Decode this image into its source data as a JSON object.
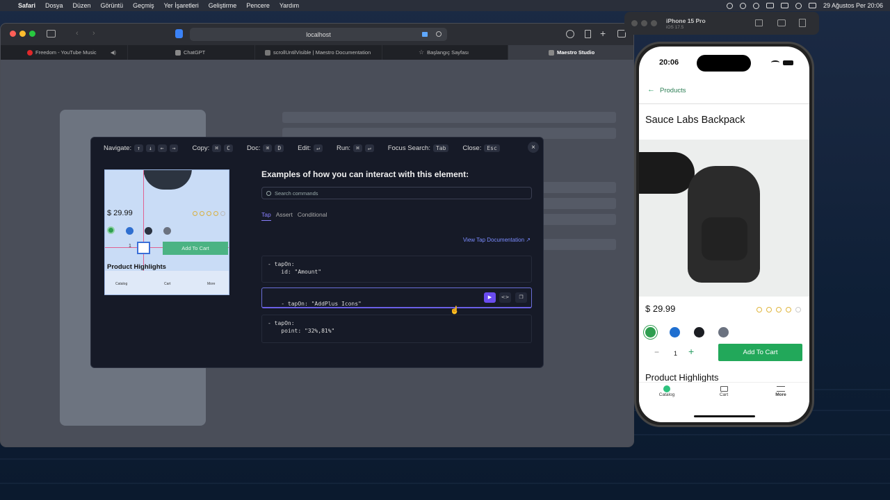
{
  "menubar": {
    "apple": "",
    "app_name": "Safari",
    "items": [
      "Dosya",
      "Düzen",
      "Görüntü",
      "Geçmiş",
      "Yer İşaretleri",
      "Geliştirme",
      "Pencere",
      "Yardım"
    ],
    "datetime": "29 Ağustos Per  20:06"
  },
  "safari": {
    "url": "localhost",
    "tabs": [
      {
        "label": "Freedom - YouTube Music",
        "icon_color": "#e0282a"
      },
      {
        "label": "ChatGPT",
        "icon_color": "#888888"
      },
      {
        "label": "scrollUntilVisible | Maestro Documentation",
        "icon_color": "#777777"
      },
      {
        "label": "Başlangıç Sayfası",
        "icon_color": "#888888"
      },
      {
        "label": "Maestro Studio",
        "icon_color": "#888888"
      }
    ]
  },
  "modal": {
    "shortcuts": [
      {
        "label": "Navigate:",
        "keys": [
          "↑",
          "↓",
          "←",
          "→"
        ]
      },
      {
        "label": "Copy:",
        "keys": [
          "⌘",
          "C"
        ]
      },
      {
        "label": "Doc:",
        "keys": [
          "⌘",
          "D"
        ]
      },
      {
        "label": "Edit:",
        "keys": [
          "↵"
        ]
      },
      {
        "label": "Run:",
        "keys": [
          "⌘",
          "↵"
        ]
      },
      {
        "label": "Focus Search:",
        "keys": [
          "Tab"
        ]
      },
      {
        "label": "Close:",
        "keys": [
          "Esc"
        ]
      }
    ],
    "close": "×",
    "title": "Examples of how you can interact with this element:",
    "search_placeholder": "Search commands",
    "tabs": [
      "Tap",
      "Assert",
      "Conditional"
    ],
    "doc_link": "View Tap Documentation ↗",
    "examples": [
      "- tapOn:\n    id: \"Amount\"",
      "- tapOn: \"AddPlus Icons\"",
      "- tapOn:\n    point: \"32%,81%\""
    ],
    "preview": {
      "price": "$ 29.99",
      "qty": "1",
      "add_to_cart": "Add To Cart",
      "highlights": "Product Highlights",
      "nav": [
        "Catalog",
        "Cart",
        "More"
      ]
    }
  },
  "simulator": {
    "device": "iPhone 15 Pro",
    "os": "iOS 17.5",
    "time": "20:06",
    "back_label": "Products",
    "product_title": "Sauce Labs Backpack",
    "price": "$ 29.99",
    "colors": [
      "#2e9e4f",
      "#1f6fd0",
      "#1b1d22",
      "#6b7280"
    ],
    "rating": 4,
    "qty": "1",
    "add_to_cart": "Add To Cart",
    "highlights": "Product Highlights",
    "nav": [
      "Catalog",
      "Cart",
      "More"
    ]
  }
}
